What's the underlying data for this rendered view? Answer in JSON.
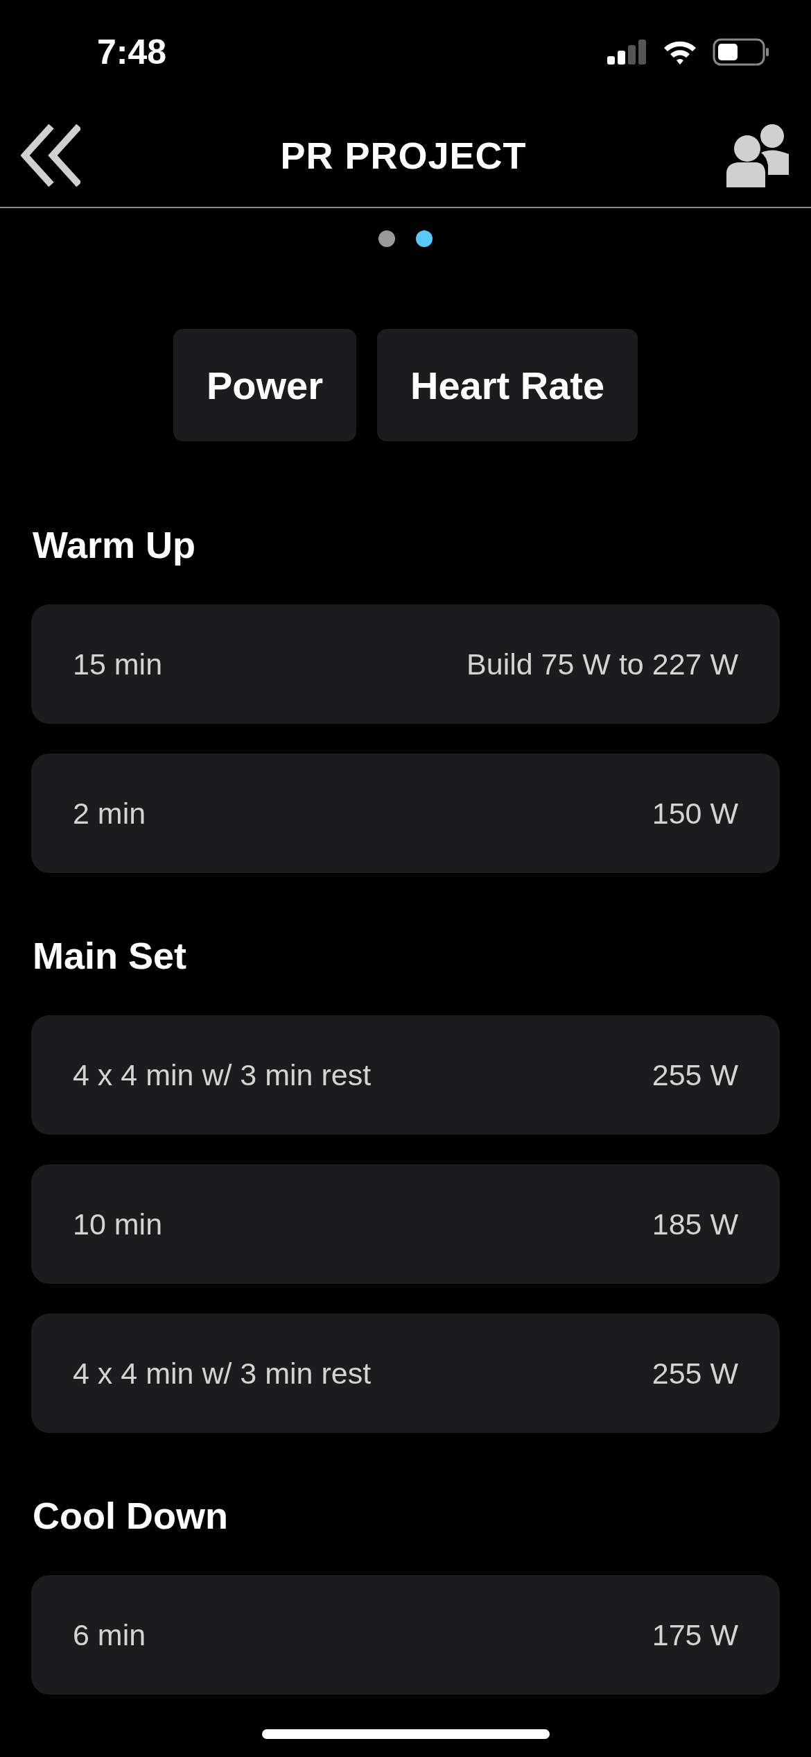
{
  "status_bar": {
    "time": "7:48"
  },
  "header": {
    "title": "PR PROJECT"
  },
  "page_dots": [
    {
      "selected": false
    },
    {
      "selected": true
    }
  ],
  "tabs": [
    {
      "label": "Power"
    },
    {
      "label": "Heart Rate"
    }
  ],
  "sections": [
    {
      "title": "Warm Up",
      "rows": [
        {
          "duration": "15 min",
          "target": "Build 75 W to 227 W"
        },
        {
          "duration": "2 min",
          "target": "150 W"
        }
      ]
    },
    {
      "title": "Main Set",
      "rows": [
        {
          "duration": "4 x 4 min w/ 3 min rest",
          "target": "255 W"
        },
        {
          "duration": "10 min",
          "target": "185 W"
        },
        {
          "duration": "4 x 4 min w/ 3 min rest",
          "target": "255 W"
        }
      ]
    },
    {
      "title": "Cool Down",
      "rows": [
        {
          "duration": "6 min",
          "target": "175 W"
        }
      ]
    }
  ]
}
